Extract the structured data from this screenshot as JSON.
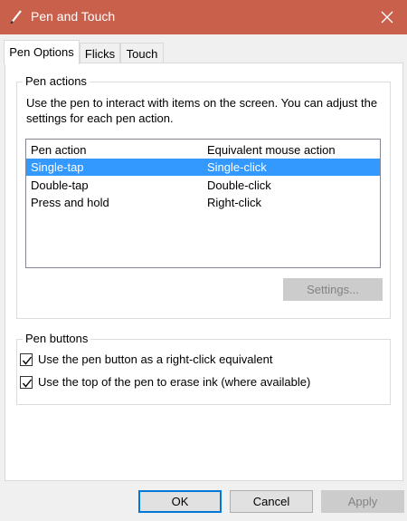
{
  "window": {
    "title": "Pen and Touch",
    "titlebar_color": "#c9604b"
  },
  "tabs": [
    {
      "label": "Pen Options",
      "active": true
    },
    {
      "label": "Flicks",
      "active": false
    },
    {
      "label": "Touch",
      "active": false
    }
  ],
  "pen_actions": {
    "group_label": "Pen actions",
    "description": "Use the pen to interact with items on the screen.  You can adjust the settings for each pen action.",
    "columns": [
      "Pen action",
      "Equivalent mouse action"
    ],
    "rows": [
      {
        "action": "Single-tap",
        "mouse": "Single-click",
        "selected": true
      },
      {
        "action": "Double-tap",
        "mouse": "Double-click",
        "selected": false
      },
      {
        "action": "Press and hold",
        "mouse": "Right-click",
        "selected": false
      }
    ],
    "settings_button": "Settings..."
  },
  "pen_buttons": {
    "group_label": "Pen buttons",
    "options": [
      {
        "label": "Use the pen button as a right-click equivalent",
        "checked": true
      },
      {
        "label": "Use the top of the pen to erase ink (where available)",
        "checked": true
      }
    ]
  },
  "footer": {
    "ok": "OK",
    "cancel": "Cancel",
    "apply": "Apply"
  },
  "colors": {
    "selection": "#3399ff",
    "default_button_border": "#0078d7"
  }
}
